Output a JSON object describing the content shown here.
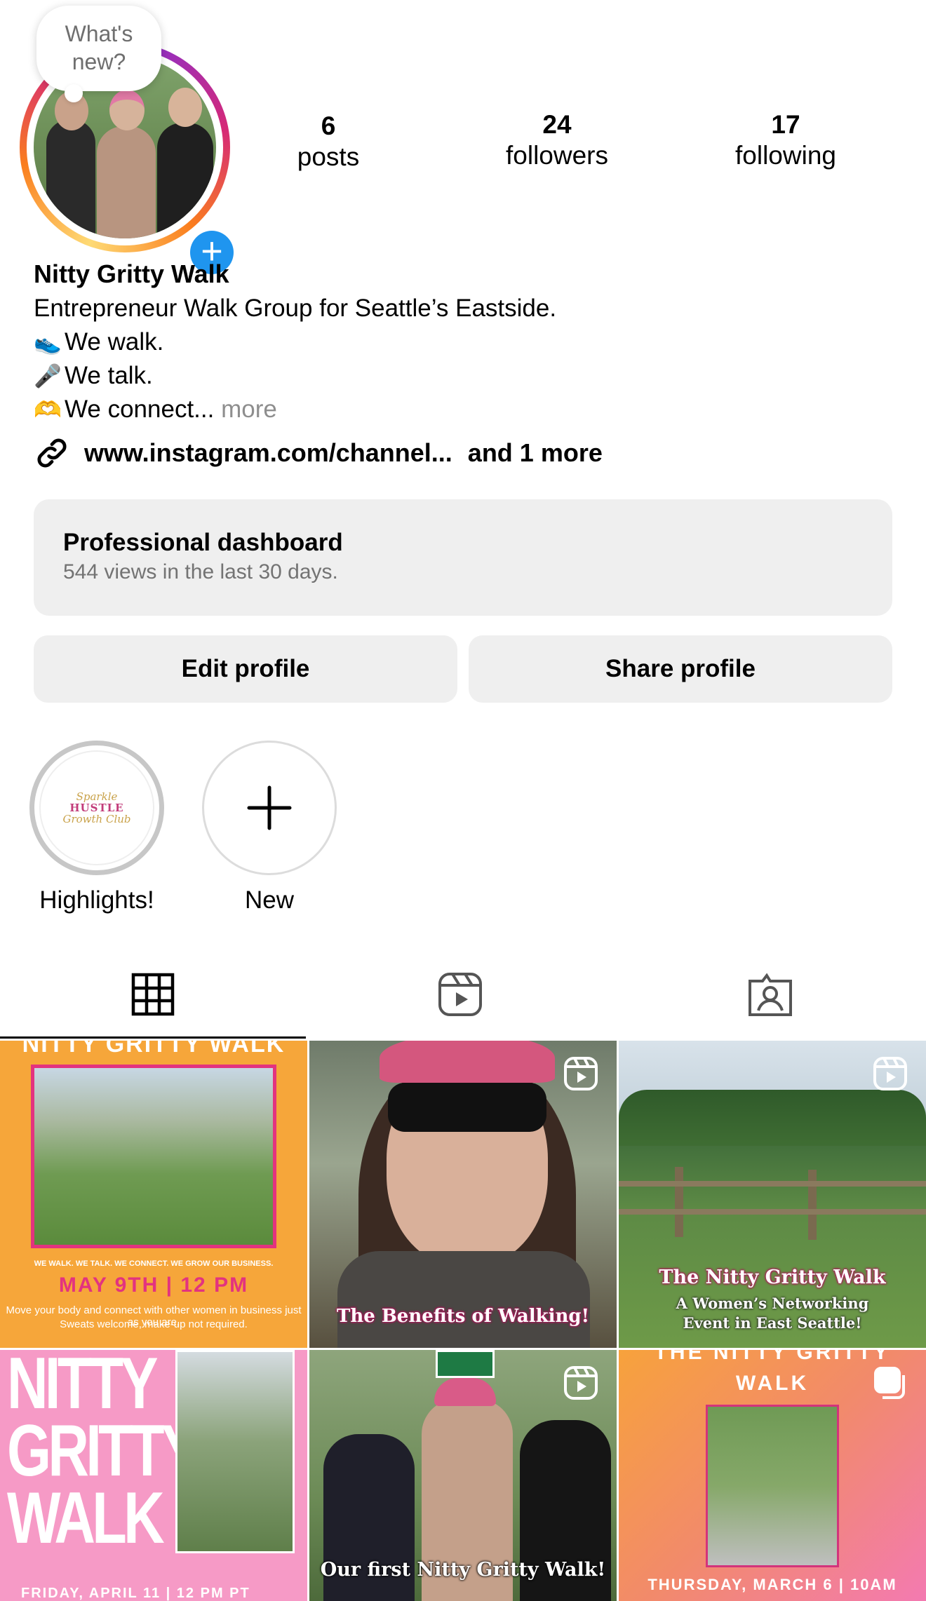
{
  "header": {
    "bubble_text": "What's new?",
    "stats": {
      "posts": {
        "value": "6",
        "label": "posts"
      },
      "followers": {
        "value": "24",
        "label": "followers"
      },
      "following": {
        "value": "17",
        "label": "following"
      }
    }
  },
  "bio": {
    "name": "Nitty Gritty Walk",
    "tagline": "Entrepreneur Walk Group for Seattle’s Eastside.",
    "lines": [
      {
        "emoji": "👟",
        "text": "We walk."
      },
      {
        "emoji": "🎤",
        "text": "We talk."
      },
      {
        "emoji": "🫶",
        "text": "We connect..."
      }
    ],
    "more": "more",
    "link": "www.instagram.com/channel...",
    "link_more": "and 1 more"
  },
  "dashboard": {
    "title": "Professional dashboard",
    "subtitle": "544 views in the last 30 days."
  },
  "buttons": {
    "edit": "Edit profile",
    "share": "Share profile"
  },
  "highlights": [
    {
      "label": "Highlights!",
      "logo_lines": [
        "Sparkle",
        "HUSTLE",
        "Growth Club"
      ]
    },
    {
      "label": "New"
    }
  ],
  "posts": [
    {
      "title": "NITTY GRITTY WALK",
      "tagline": "WE WALK. WE TALK. WE CONNECT. WE GROW OUR BUSINESS.",
      "date": "MAY 9TH | 12 PM",
      "sub1": "Move your body and connect with other women in business just as you are.",
      "sub2": "Sweats welcome, make-up not required."
    },
    {
      "caption": "The Benefits of Walking!"
    },
    {
      "caption": "The Nitty Gritty Walk",
      "caption2": "A Women’s Networking",
      "caption3": "Event in East Seattle!"
    },
    {
      "lines": [
        "NITTY",
        "GRITTY",
        "WALK"
      ],
      "footer": "FRIDAY, APRIL 11 | 12 PM PT"
    },
    {
      "caption": "Our first Nitty Gritty Walk!"
    },
    {
      "lines": [
        "THE NITTY GRITTY",
        "WALK"
      ],
      "footer": "THURSDAY, MARCH 6 | 10AM"
    }
  ],
  "colors": {
    "accent_blue": "#1f95ef",
    "brand_pink": "#e3337f",
    "button_gray": "#efefef",
    "muted_text": "#737373"
  }
}
